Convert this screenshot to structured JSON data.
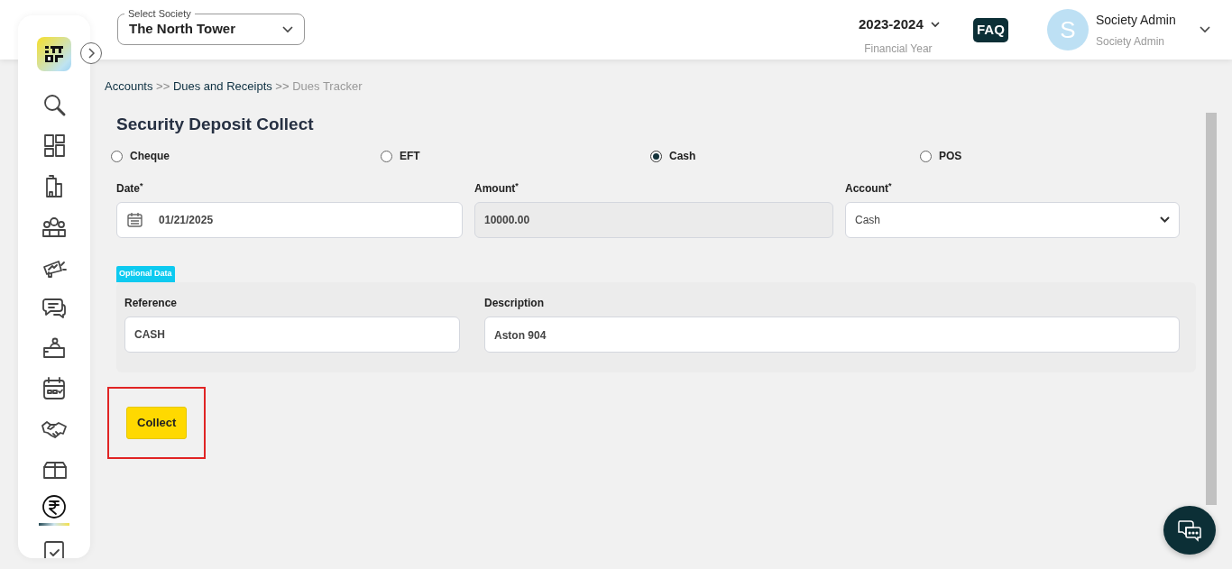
{
  "sidebar": {
    "items": [
      {
        "kind": "search",
        "selected": false
      },
      {
        "kind": "dashboard",
        "selected": false
      },
      {
        "kind": "building",
        "selected": false
      },
      {
        "kind": "people",
        "selected": false
      },
      {
        "kind": "megaphone",
        "selected": false
      },
      {
        "kind": "chat",
        "selected": false
      },
      {
        "kind": "desk",
        "selected": false
      },
      {
        "kind": "calendar",
        "selected": false
      },
      {
        "kind": "handshake",
        "selected": false
      },
      {
        "kind": "box",
        "selected": false
      },
      {
        "kind": "rupee",
        "selected": true
      },
      {
        "kind": "clipboard",
        "selected": false
      }
    ]
  },
  "header": {
    "society": {
      "label": "Select Society",
      "value": "The North Tower"
    },
    "financial_year": {
      "value": "2023-2024",
      "caption": "Financial Year"
    },
    "faq": "FAQ",
    "user": {
      "initial": "S",
      "name": "Society Admin",
      "role": "Society Admin"
    }
  },
  "breadcrumb": [
    {
      "text": "Accounts",
      "current": false
    },
    {
      "text": "Dues and Receipts",
      "current": false
    },
    {
      "text": "Dues Tracker",
      "current": true
    }
  ],
  "breadcrumb_separator": ">>",
  "form": {
    "title": "Security Deposit Collect",
    "payment_modes": [
      {
        "label": "Cheque",
        "selected": false
      },
      {
        "label": "EFT",
        "selected": false
      },
      {
        "label": "Cash",
        "selected": true
      },
      {
        "label": "POS",
        "selected": false
      }
    ],
    "fields": [
      {
        "kind": "date",
        "label": "Date",
        "required_mark": "*",
        "value": "01/21/2025",
        "disabled": false
      },
      {
        "kind": "text",
        "label": "Amount",
        "required_mark": "*",
        "value": "10000.00",
        "disabled": true
      },
      {
        "kind": "select",
        "label": "Account",
        "required_mark": "*",
        "value": "Cash",
        "disabled": false
      }
    ],
    "optional_badge": "Optional Data",
    "optional_fields": [
      {
        "kind": "text",
        "label": "Reference",
        "value": "CASH"
      },
      {
        "kind": "textarea",
        "label": "Description",
        "value": "Aston 904"
      }
    ],
    "submit": {
      "label": "Collect",
      "highlighted": true
    }
  }
}
